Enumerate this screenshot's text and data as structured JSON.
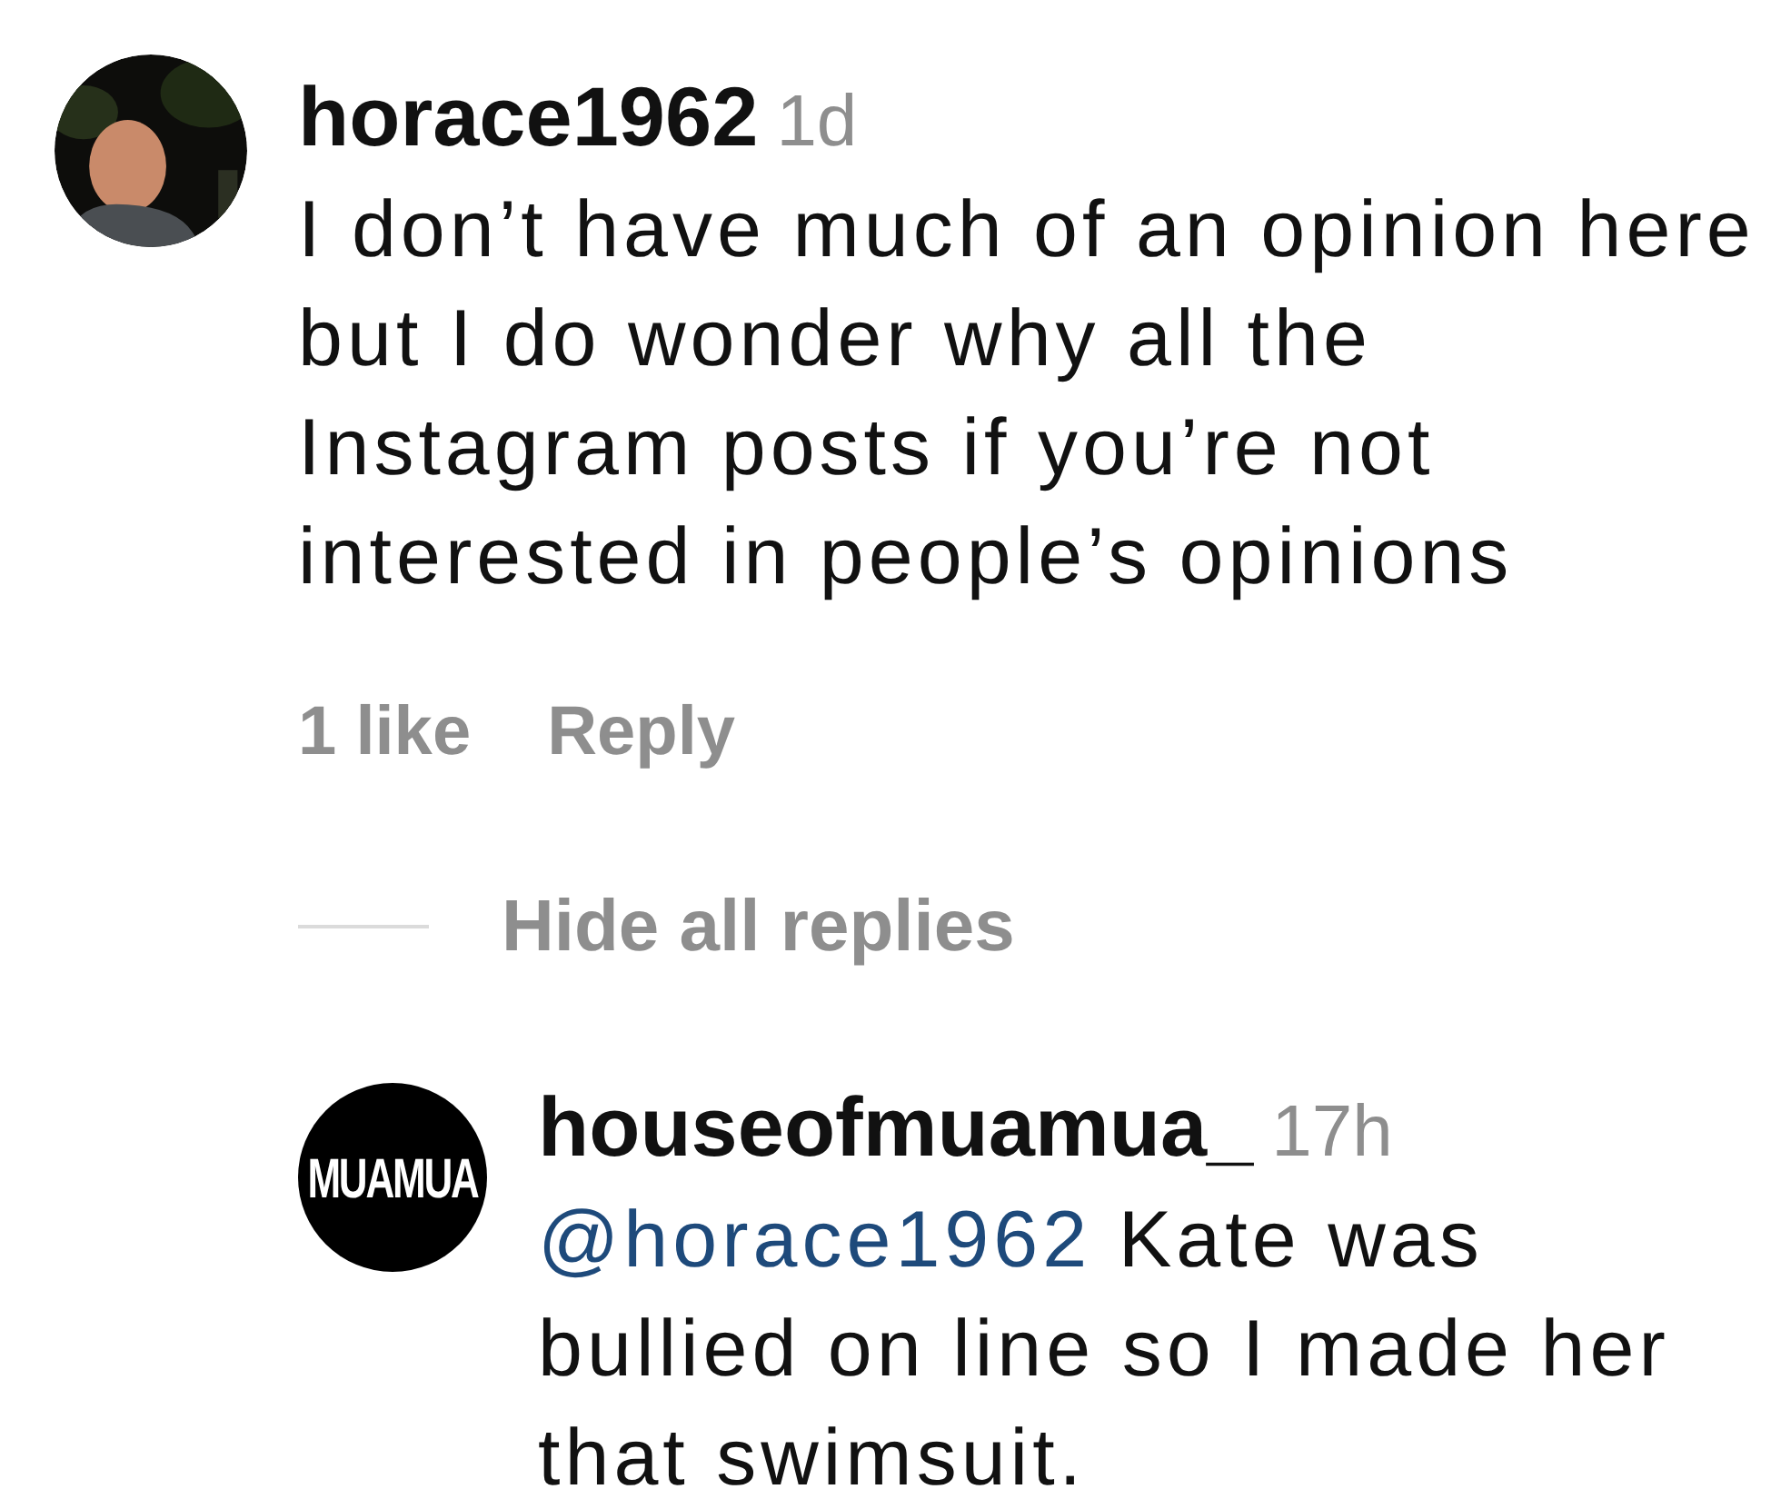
{
  "comment": {
    "username": "horace1962",
    "time": "1d",
    "text": "I don’t have much of an opinion here but I do wonder why all the Instagram posts if you’re not interested in people’s opinions",
    "likes": "1 like",
    "reply_label": "Reply"
  },
  "replies_toggle": {
    "label": "Hide all replies"
  },
  "replies": [
    {
      "username": "houseofmuamua_",
      "time": "17h",
      "mention": "@horace1962",
      "text": "Kate was bullied on line so I made her that swimsuit.",
      "avatar": {
        "kind": "logo",
        "text": "MUAMUA"
      }
    }
  ]
}
